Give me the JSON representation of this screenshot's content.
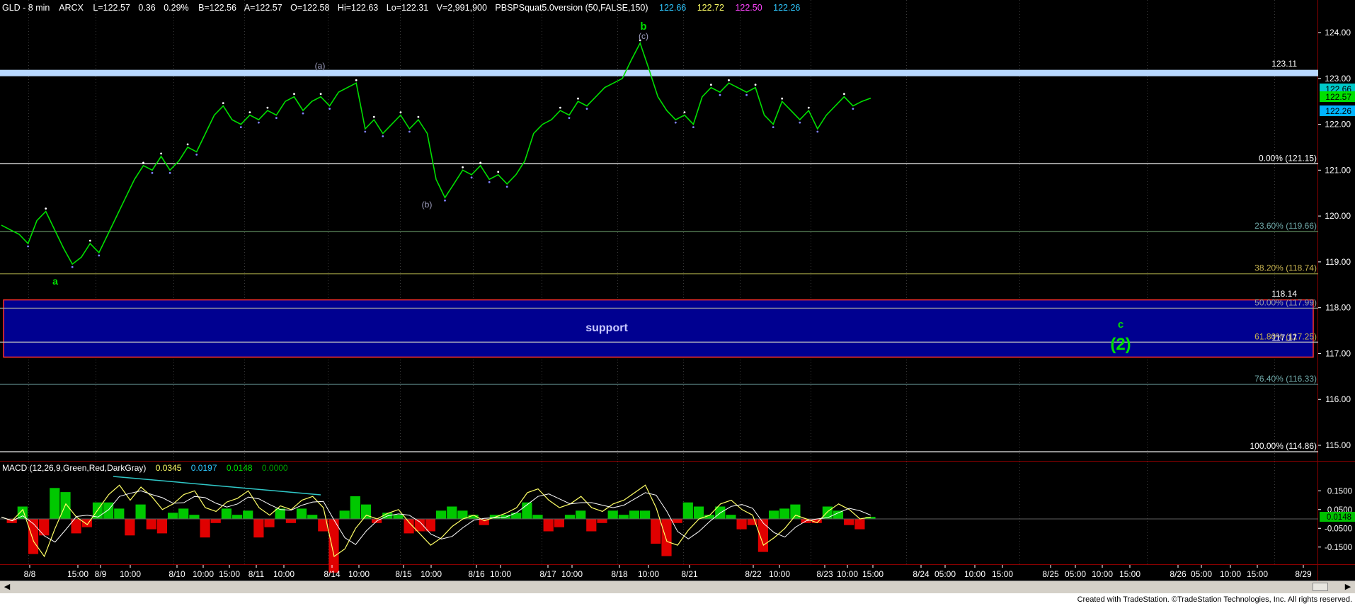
{
  "header": {
    "symbol": "GLD - 8 min",
    "exchange": "ARCX",
    "last": "L=122.57",
    "change": "0.36",
    "change_pct": "0.29%",
    "bid": "B=122.56",
    "ask": "A=122.57",
    "open": "O=122.58",
    "high": "Hi=122.63",
    "low": "Lo=122.31",
    "volume": "V=2,991,900",
    "study": "PBSPSquat5.0version (50,FALSE,150)",
    "study_vals": [
      "122.66",
      "122.72",
      "122.50",
      "122.26"
    ],
    "study_colors": [
      "#2ec8ff",
      "#ffff66",
      "#ff44ff",
      "#2ec8ff"
    ]
  },
  "price_scale": {
    "ticks": [
      "124.00",
      "123.00",
      "122.00",
      "121.00",
      "120.00",
      "119.00",
      "118.00",
      "117.00",
      "116.00",
      "115.00"
    ],
    "badges": [
      {
        "text": "122.66",
        "bg": "#00c8c8",
        "fg": "#000000",
        "v": 122.66
      },
      {
        "text": "122.57",
        "bg": "#00e000",
        "fg": "#000000",
        "v": 122.57
      },
      {
        "text": "122.26",
        "bg": "#00b4ff",
        "fg": "#000000",
        "v": 122.26
      }
    ]
  },
  "levels": {
    "resistance_label": "123.11",
    "support_top_label": "118.14",
    "support_bottom_label": "117.17",
    "support_text": "support"
  },
  "fib_levels": [
    {
      "label": "0.00%",
      "value": "(121.15)",
      "v": 121.14,
      "color": "#ffffff",
      "text_color": "#ffffff"
    },
    {
      "label": "23.60%",
      "value": "(119.66)",
      "v": 119.66,
      "color": "#5f8c5f",
      "text_color": "#6fa8a8"
    },
    {
      "label": "38.20%",
      "value": "(118.74)",
      "v": 118.74,
      "color": "#8c8c3c",
      "text_color": "#c8b450"
    },
    {
      "label": "50.00%",
      "value": "(117.99)",
      "v": 117.99,
      "color": "#a0a0a0",
      "text_color": "#a0a0a0"
    },
    {
      "label": "61.80%",
      "value": "(117.25)",
      "v": 117.25,
      "color": "#c0c0c0",
      "text_color": "#c8b450"
    },
    {
      "label": "76.40%",
      "value": "(116.33)",
      "v": 116.33,
      "color": "#5f8c8c",
      "text_color": "#6fa8a8"
    },
    {
      "label": "100.00%",
      "value": "(114.86)",
      "v": 114.86,
      "color": "#ffffff",
      "text_color": "#ffffff"
    }
  ],
  "wave_labels": [
    {
      "text": "a",
      "color": "#00e000",
      "bold": true
    },
    {
      "text": "b",
      "color": "#00e000",
      "bold": true
    },
    {
      "text": "(c)",
      "color": "#a0a0c0",
      "bold": false
    },
    {
      "text": "(a)",
      "color": "#a0a0c0",
      "bold": false
    },
    {
      "text": "(b)",
      "color": "#a0a0c0",
      "bold": false
    },
    {
      "text": "c",
      "color": "#00e000",
      "bold": true
    },
    {
      "text": "(2)",
      "color": "#00e000",
      "bold": true
    }
  ],
  "macd": {
    "title": "MACD (12,26,9,Green,Red,DarkGray)",
    "values": [
      {
        "text": "0.0345",
        "color": "#ffff66"
      },
      {
        "text": "0.0197",
        "color": "#2ec8ff"
      },
      {
        "text": "0.0148",
        "color": "#00e000"
      },
      {
        "text": "0.0000",
        "color": "#00a000"
      }
    ],
    "ticks": [
      "0.1500",
      "0.0500",
      "-0.0500",
      "-0.1500"
    ],
    "badge": "0.0148"
  },
  "time_axis": {
    "labels": [
      "8/8",
      "15:00",
      "8/9",
      "10:00",
      "8/10",
      "10:00",
      "15:00",
      "8/11",
      "10:00",
      "8/14",
      "10:00",
      "8/15",
      "10:00",
      "8/16",
      "10:00",
      "8/17",
      "10:00",
      "8/18",
      "10:00",
      "8/21",
      "8/22",
      "10:00",
      "8/23",
      "10:00",
      "15:00",
      "8/24",
      "05:00",
      "10:00",
      "15:00",
      "8/25",
      "05:00",
      "10:00",
      "15:00",
      "8/26",
      "05:00",
      "10:00",
      "15:00",
      "8/29"
    ]
  },
  "footer": {
    "credit": "Created with TradeStation. ©TradeStation Technologies, Inc. All rights reserved."
  },
  "chart_data": {
    "type": "line",
    "title": "GLD - 8 min",
    "y_axis": "price",
    "ylim": [
      114.6,
      124.35
    ],
    "key_points": {
      "wave_a_low": 118.92,
      "wave_a_of_b_high": 122.92,
      "wave_b_of_b_low": 120.41,
      "wave_b_high": 123.77,
      "last_price": 122.57
    },
    "resistance_band": 123.11,
    "support_zone": [
      117.17,
      118.14
    ],
    "close_series": [
      119.8,
      119.7,
      119.6,
      119.4,
      119.9,
      120.1,
      119.7,
      119.3,
      118.95,
      119.1,
      119.4,
      119.2,
      119.6,
      120.0,
      120.4,
      120.8,
      121.1,
      121.0,
      121.3,
      121.0,
      121.2,
      121.5,
      121.4,
      121.8,
      122.2,
      122.4,
      122.1,
      122.0,
      122.2,
      122.1,
      122.3,
      122.2,
      122.5,
      122.6,
      122.3,
      122.5,
      122.6,
      122.4,
      122.7,
      122.8,
      122.9,
      121.9,
      122.1,
      121.8,
      122.0,
      122.2,
      121.9,
      122.1,
      121.8,
      120.8,
      120.4,
      120.7,
      121.0,
      120.9,
      121.1,
      120.8,
      120.9,
      120.7,
      120.9,
      121.2,
      121.8,
      122.0,
      122.1,
      122.3,
      122.2,
      122.5,
      122.4,
      122.6,
      122.8,
      122.9,
      123.0,
      123.4,
      123.77,
      123.2,
      122.6,
      122.3,
      122.1,
      122.2,
      122.0,
      122.6,
      122.8,
      122.7,
      122.9,
      122.8,
      122.7,
      122.8,
      122.2,
      122.0,
      122.5,
      122.3,
      122.1,
      122.3,
      121.9,
      122.2,
      122.4,
      122.6,
      122.4,
      122.5,
      122.57
    ],
    "macd_series": [
      0.01,
      -0.01,
      0.05,
      -0.12,
      -0.2,
      -0.05,
      0.08,
      0.01,
      -0.03,
      0.05,
      0.13,
      0.18,
      0.1,
      0.17,
      0.12,
      0.05,
      0.08,
      0.13,
      0.15,
      0.06,
      0.04,
      0.09,
      0.11,
      0.15,
      0.06,
      0.02,
      0.07,
      0.05,
      0.1,
      0.12,
      0.06,
      -0.2,
      -0.16,
      -0.05,
      0.02,
      0.0,
      0.03,
      0.05,
      -0.02,
      -0.08,
      -0.14,
      -0.1,
      -0.04,
      0.0,
      0.02,
      -0.01,
      0.01,
      0.03,
      0.06,
      0.14,
      0.16,
      0.1,
      0.06,
      0.08,
      0.12,
      0.06,
      0.04,
      0.08,
      0.1,
      0.14,
      0.18,
      0.06,
      -0.12,
      -0.14,
      -0.06,
      0.0,
      0.02,
      0.08,
      0.1,
      0.05,
      0.02,
      -0.14,
      -0.1,
      -0.05,
      0.02,
      0.0,
      -0.02,
      0.04,
      0.08,
      0.05,
      0.0,
      0.01
    ]
  }
}
